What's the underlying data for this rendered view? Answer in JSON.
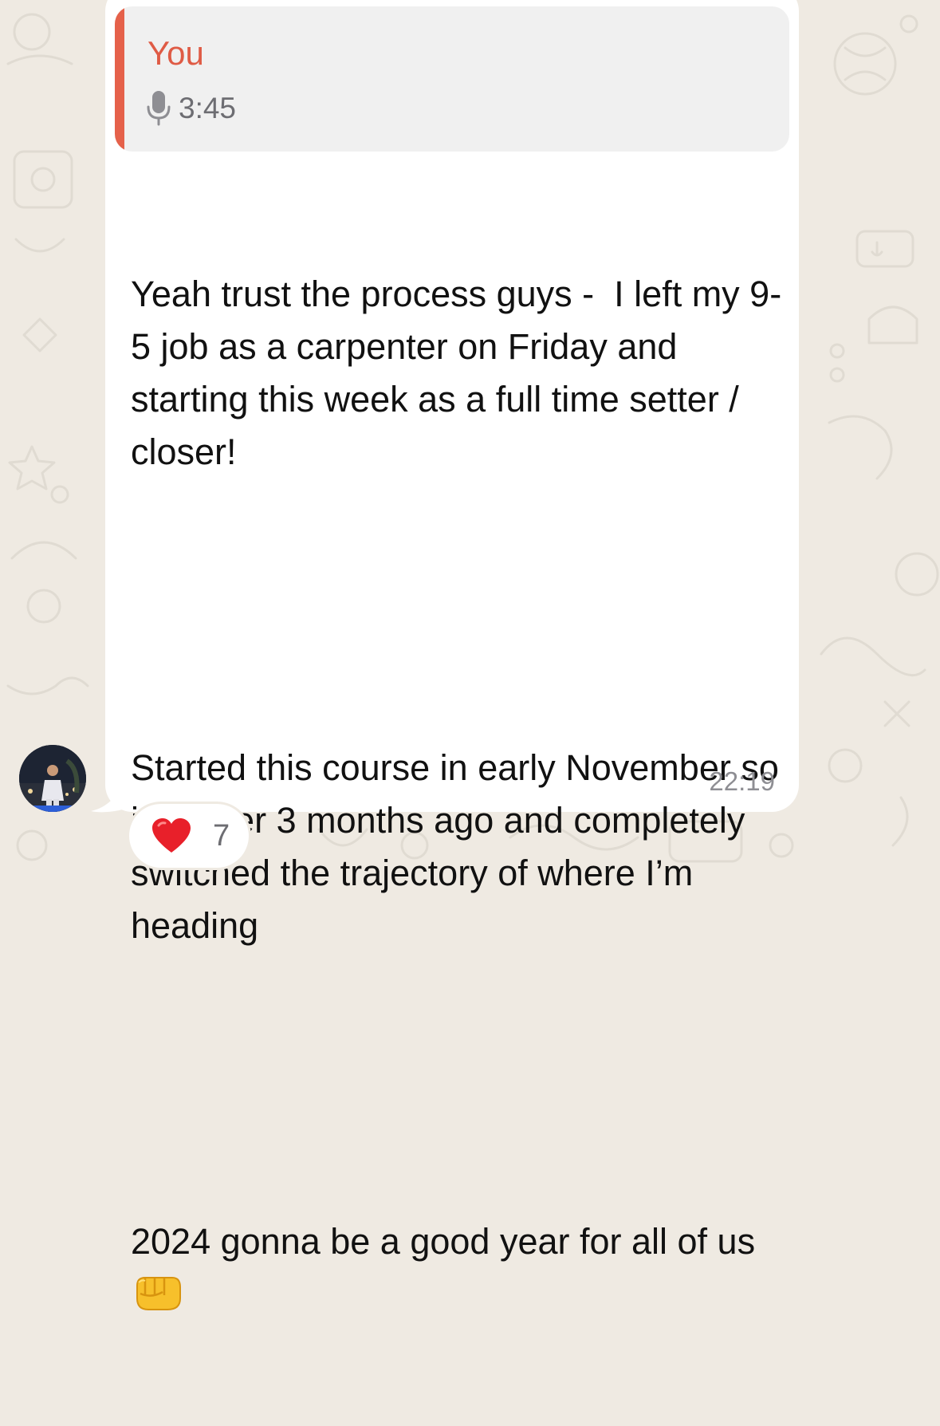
{
  "quote": {
    "author": "You",
    "voice_duration": "3:45",
    "icon": "microphone-icon"
  },
  "message": {
    "paragraph_1": "Yeah trust the process guys -  I left my 9-5 job as a carpenter on Friday and starting this week as a full time setter / closer!",
    "paragraph_2": "Started this course in early November so just over 3 months ago and completely switched the trajectory of where I’m heading",
    "paragraph_3": "2024 gonna be a good year for all of us",
    "emoji": "oncoming-fist-emoji",
    "time": "22:19"
  },
  "reaction": {
    "icon": "red-heart-icon",
    "count": "7"
  },
  "avatar": {
    "icon": "sender-avatar"
  },
  "colors": {
    "background": "#efeae2",
    "bubble": "#ffffff",
    "quote_background": "#f0f0f0",
    "quote_accent": "#e5614a",
    "quote_author": "#df5b45",
    "meta_text": "#8e8e93"
  }
}
